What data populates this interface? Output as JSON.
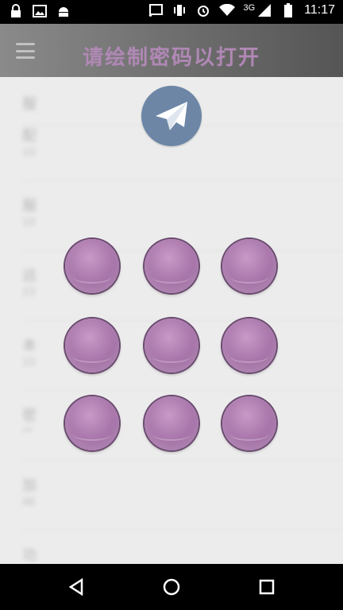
{
  "status_bar": {
    "network": "3G",
    "time": "11:17"
  },
  "header": {
    "title": "请绘制密码以打开"
  },
  "background_list": [
    {
      "label": "服",
      "sub": ""
    },
    {
      "label": "配",
      "sub": "10"
    },
    {
      "label": "服",
      "sub": "10"
    },
    {
      "label": "远",
      "sub": "23"
    },
    {
      "label": "本",
      "sub": "10"
    },
    {
      "label": "密",
      "sub": "**"
    },
    {
      "label": "加",
      "sub": "AE"
    },
    {
      "label": "功",
      "sub": ""
    }
  ],
  "pattern": {
    "rows": 3,
    "cols": 3
  },
  "colors": {
    "title": "#b088b5",
    "dot": "#a774a9",
    "avatar": "#6d86a6"
  }
}
